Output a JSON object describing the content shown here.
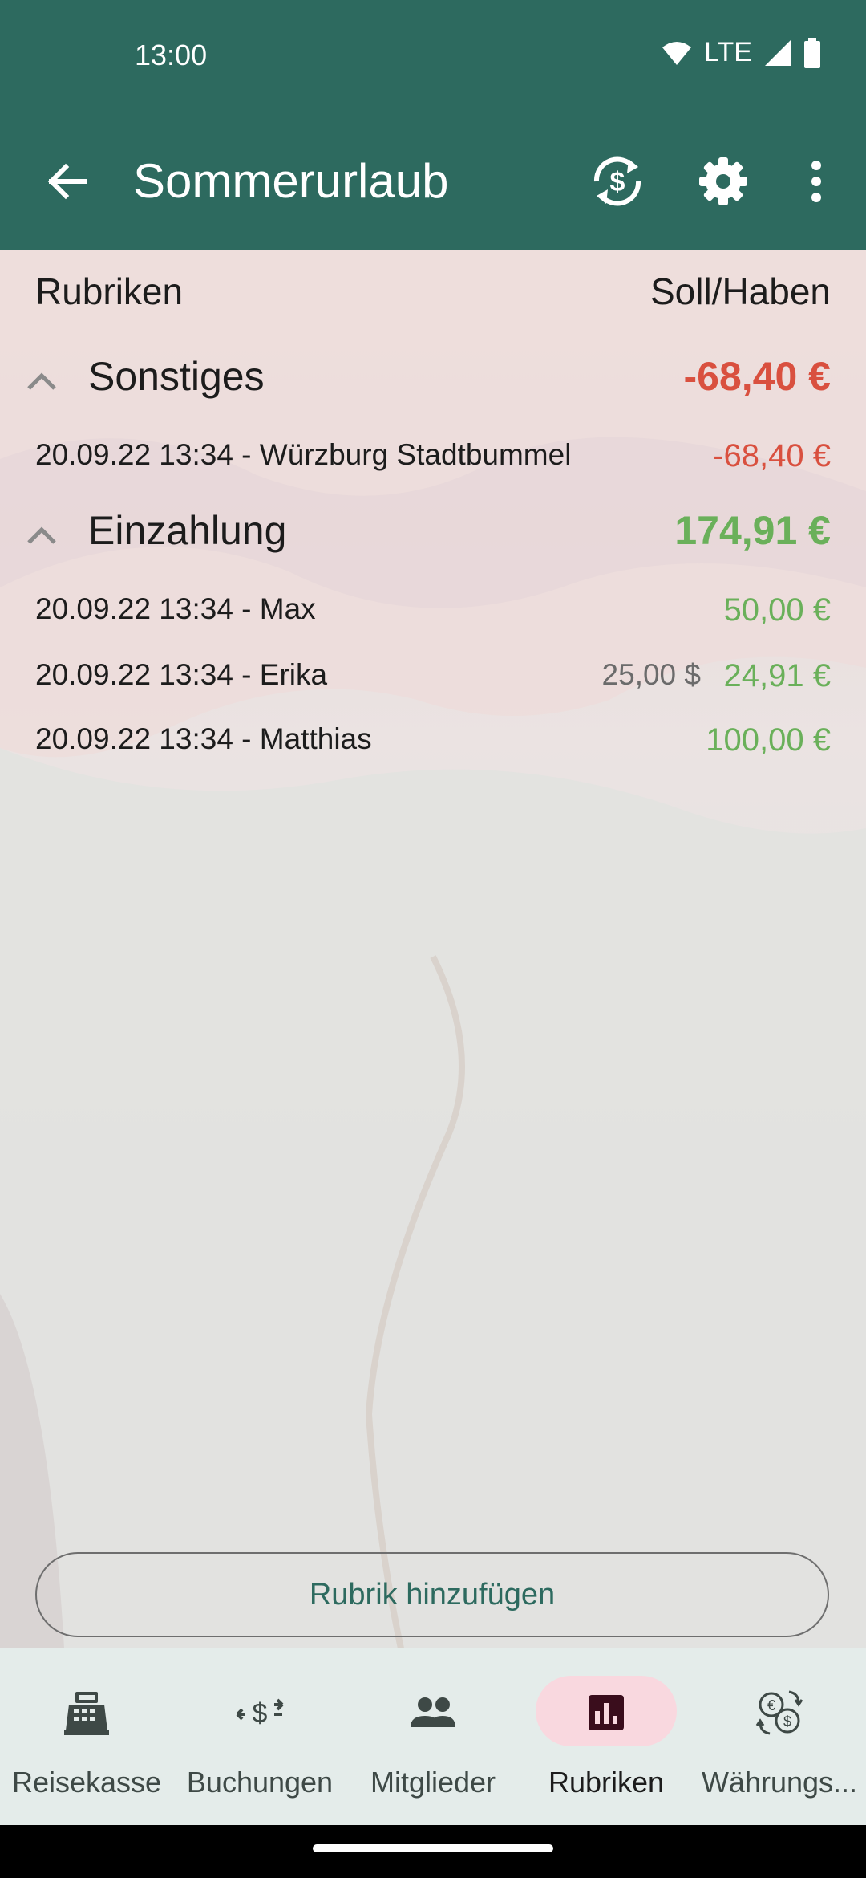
{
  "status_bar": {
    "time": "13:00",
    "network": "LTE"
  },
  "app_bar": {
    "title": "Sommerurlaub",
    "icons": [
      "back-arrow-icon",
      "currency-sync-icon",
      "settings-gear-icon",
      "more-vert-icon"
    ]
  },
  "table_header": {
    "left": "Rubriken",
    "right": "Soll/Haben"
  },
  "groups": [
    {
      "name": "Sonstiges",
      "total": "-68,40 €",
      "items": [
        {
          "label": "20.09.22 13:34 -  Würzburg Stadtbummel",
          "amount": "-68,40 €"
        }
      ]
    },
    {
      "name": "Einzahlung",
      "total": "174,91 €",
      "items": [
        {
          "label": "20.09.22 13:34 - Max",
          "amount": "50,00 €"
        },
        {
          "label": "20.09.22 13:34 - Erika",
          "foreign": "25,00 $",
          "amount": "24,91 €"
        },
        {
          "label": "20.09.22 13:34 - Matthias",
          "amount": "100,00 €"
        }
      ]
    }
  ],
  "add_button": "Rubrik hinzufügen",
  "bottom_nav": [
    {
      "label": "Reisekasse",
      "icon": "cash-register-icon",
      "active": false
    },
    {
      "label": "Buchungen",
      "icon": "transfer-dollar-icon",
      "active": false
    },
    {
      "label": "Mitglieder",
      "icon": "group-people-icon",
      "active": false
    },
    {
      "label": "Rubriken",
      "icon": "bar-chart-icon",
      "active": true
    },
    {
      "label": "Währungs...",
      "icon": "currency-exchange-icon",
      "active": false
    }
  ],
  "colors": {
    "primary": "#2d6a5f",
    "negative": "#d9503f",
    "positive": "#6ab05a",
    "nav_active_pill": "#f9d8df"
  }
}
